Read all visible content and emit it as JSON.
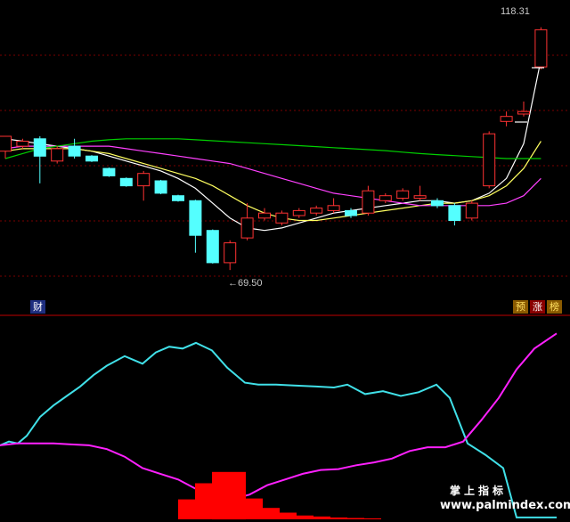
{
  "colors": {
    "background": "#000000",
    "grid": "#7a0000",
    "divider": "#c00000",
    "up_candle": "#ff3232",
    "down_candle": "#54ffff",
    "ma_white": "#ffffff",
    "ma_yellow": "#ffff60",
    "ma_magenta": "#ff40ff",
    "ma_green": "#00d000",
    "ind_cyan": "#40e0e8",
    "ind_magenta": "#ff20ff",
    "ind_bar": "#ff0000"
  },
  "price_panel": {
    "high_label": "118.31",
    "low_label": "69.50",
    "low_arrow_icon": "left-arrow-icon",
    "left_badge": "财",
    "right_badges": [
      "预",
      "涨",
      "榜"
    ]
  },
  "watermark": {
    "title": "掌上指标",
    "url": "www.palmindex.com"
  },
  "chart_data": [
    {
      "type": "candlestick",
      "title": "",
      "ylim": [
        60,
        124
      ],
      "grid": true,
      "annotations": [
        "118.31",
        "69.50"
      ],
      "candles": [
        {
          "o": 93.5,
          "c": 96.5,
          "h": 96.5,
          "l": 92.0
        },
        {
          "o": 94.5,
          "c": 95.5,
          "h": 96.0,
          "l": 94.0
        },
        {
          "o": 96.0,
          "c": 92.5,
          "h": 96.5,
          "l": 87.0
        },
        {
          "o": 91.5,
          "c": 94.0,
          "h": 94.5,
          "l": 91.0
        },
        {
          "o": 94.5,
          "c": 92.5,
          "h": 96.0,
          "l": 92.0
        },
        {
          "o": 92.5,
          "c": 91.5,
          "h": 92.7,
          "l": 91.3
        },
        {
          "o": 90.0,
          "c": 88.5,
          "h": 90.2,
          "l": 88.3
        },
        {
          "o": 88.0,
          "c": 86.5,
          "h": 88.2,
          "l": 86.3
        },
        {
          "o": 86.5,
          "c": 89.0,
          "h": 89.5,
          "l": 83.5
        },
        {
          "o": 87.5,
          "c": 85.0,
          "h": 87.7,
          "l": 84.8
        },
        {
          "o": 84.5,
          "c": 83.5,
          "h": 84.7,
          "l": 83.3
        },
        {
          "o": 83.5,
          "c": 76.5,
          "h": 83.7,
          "l": 73.0
        },
        {
          "o": 77.5,
          "c": 71.0,
          "h": 77.7,
          "l": 70.8
        },
        {
          "o": 71.0,
          "c": 75.0,
          "h": 75.5,
          "l": 69.5
        },
        {
          "o": 76.0,
          "c": 80.0,
          "h": 83.0,
          "l": 75.5
        },
        {
          "o": 80.0,
          "c": 81.0,
          "h": 82.0,
          "l": 79.5
        },
        {
          "o": 79.0,
          "c": 81.0,
          "h": 81.5,
          "l": 78.5
        },
        {
          "o": 80.5,
          "c": 81.5,
          "h": 82.0,
          "l": 80.0
        },
        {
          "o": 81.0,
          "c": 82.0,
          "h": 82.5,
          "l": 80.5
        },
        {
          "o": 81.5,
          "c": 82.5,
          "h": 84.0,
          "l": 81.0
        },
        {
          "o": 81.5,
          "c": 80.5,
          "h": 82.0,
          "l": 80.0
        },
        {
          "o": 81.0,
          "c": 85.5,
          "h": 86.5,
          "l": 80.5
        },
        {
          "o": 83.5,
          "c": 84.5,
          "h": 85.0,
          "l": 83.0
        },
        {
          "o": 84.0,
          "c": 85.5,
          "h": 86.0,
          "l": 83.5
        },
        {
          "o": 84.0,
          "c": 84.5,
          "h": 86.5,
          "l": 83.5
        },
        {
          "o": 83.5,
          "c": 82.5,
          "h": 84.0,
          "l": 82.0
        },
        {
          "o": 82.5,
          "c": 79.5,
          "h": 83.0,
          "l": 78.5
        },
        {
          "o": 80.0,
          "c": 83.0,
          "h": 83.5,
          "l": 79.5
        },
        {
          "o": 86.5,
          "c": 97.0,
          "h": 97.5,
          "l": 86.0
        },
        {
          "o": 99.5,
          "c": 100.5,
          "h": 101.5,
          "l": 98.5
        },
        {
          "o": 101.0,
          "c": 101.5,
          "h": 103.5,
          "l": 100.5
        },
        {
          "o": 110.5,
          "c": 118.0,
          "h": 118.5,
          "l": 110.0
        }
      ],
      "series": [
        {
          "color": "ma_white",
          "values": [
            96.0,
            95.5,
            95.0,
            94.5,
            94.0,
            93.5,
            92.5,
            91.5,
            90.5,
            89.5,
            88.0,
            86.0,
            83.0,
            80.0,
            78.0,
            77.5,
            78.0,
            79.0,
            80.0,
            81.0,
            81.5,
            82.0,
            82.5,
            83.0,
            83.5,
            83.5,
            83.0,
            83.5,
            85.0,
            88.0,
            95.0,
            112.0
          ]
        },
        {
          "color": "ma_yellow",
          "values": [
            93.5,
            94.0,
            94.0,
            94.0,
            94.0,
            93.5,
            93.0,
            92.0,
            91.0,
            90.0,
            89.0,
            88.0,
            86.5,
            84.5,
            82.5,
            81.0,
            80.0,
            79.5,
            79.5,
            80.0,
            80.5,
            81.0,
            81.5,
            82.0,
            82.5,
            83.0,
            83.0,
            83.5,
            84.5,
            86.5,
            90.0,
            95.5
          ]
        },
        {
          "color": "ma_magenta",
          "values": [
            94.0,
            94.5,
            94.5,
            94.5,
            94.5,
            94.5,
            94.5,
            94.0,
            93.5,
            93.0,
            92.5,
            92.0,
            91.5,
            91.0,
            90.0,
            89.0,
            88.0,
            87.0,
            86.0,
            85.0,
            84.5,
            84.0,
            83.5,
            83.0,
            82.5,
            82.5,
            82.5,
            82.5,
            82.5,
            83.0,
            84.5,
            88.0
          ]
        },
        {
          "color": "ma_green",
          "values": [
            92.0,
            93.0,
            94.0,
            94.5,
            95.0,
            95.5,
            95.8,
            96.0,
            96.0,
            96.0,
            96.0,
            95.8,
            95.6,
            95.4,
            95.2,
            95.0,
            94.8,
            94.6,
            94.4,
            94.2,
            94.0,
            93.8,
            93.6,
            93.3,
            93.0,
            92.8,
            92.6,
            92.4,
            92.2,
            92.0,
            92.0,
            92.0
          ]
        }
      ]
    },
    {
      "type": "line",
      "title": "",
      "ylim": [
        0,
        100
      ],
      "grid": false,
      "series": [
        {
          "color": "ind_cyan",
          "x": [
            0,
            10,
            20,
            30,
            45,
            60,
            75,
            90,
            105,
            120,
            140,
            160,
            175,
            190,
            205,
            220,
            238,
            255,
            275,
            290,
            310,
            330,
            355,
            375,
            390,
            410,
            430,
            450,
            470,
            490,
            505,
            525,
            545,
            565,
            580,
            600,
            625
          ],
          "values": [
            39,
            41,
            40,
            44,
            54,
            60,
            65,
            70,
            76,
            81,
            86,
            82,
            88,
            91,
            90,
            93,
            89,
            80,
            72,
            71,
            71,
            70.5,
            70,
            69.5,
            71,
            66,
            67.5,
            65,
            67,
            71,
            64,
            40,
            34,
            27,
            1,
            1,
            1
          ]
        },
        {
          "color": "ind_magenta",
          "x": [
            0,
            20,
            40,
            60,
            80,
            100,
            120,
            140,
            160,
            180,
            200,
            220,
            240,
            260,
            280,
            300,
            320,
            340,
            360,
            380,
            400,
            420,
            440,
            460,
            480,
            500,
            520,
            540,
            560,
            580,
            600,
            625
          ],
          "values": [
            39,
            40,
            40,
            40,
            39.5,
            39,
            37,
            33,
            27,
            24,
            21,
            16,
            12,
            10.5,
            13,
            18,
            21,
            24,
            26,
            26.5,
            28.5,
            30,
            32,
            36,
            38,
            38,
            41,
            52,
            64,
            79,
            90,
            98
          ]
        },
        {
          "color": "ind_bar",
          "type": "bar",
          "x": [
            200,
            219,
            238,
            257,
            276,
            295,
            314,
            333,
            352,
            371,
            390,
            409
          ],
          "values": [
            10.5,
            19,
            25,
            25,
            11,
            6,
            3.5,
            2,
            1.5,
            1,
            0.7,
            0.5
          ]
        }
      ]
    }
  ]
}
